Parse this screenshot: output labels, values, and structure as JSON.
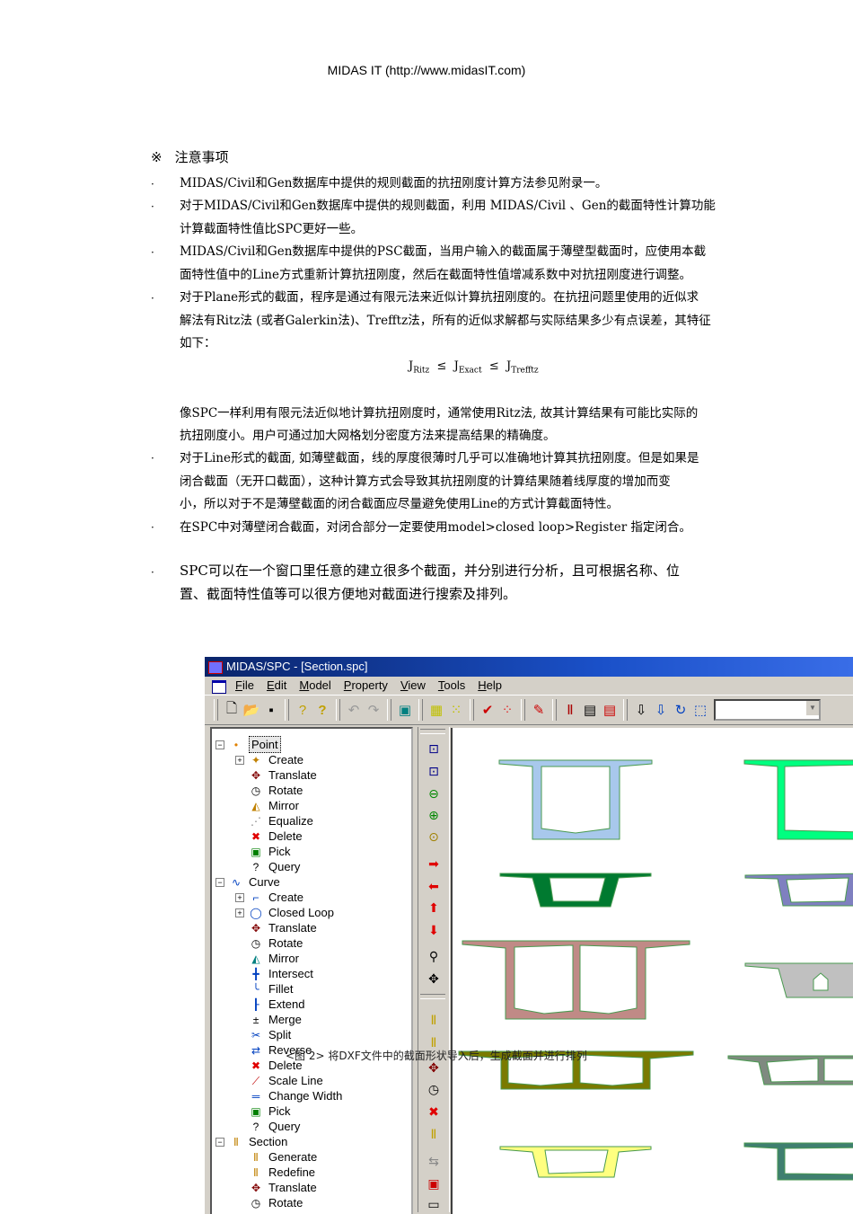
{
  "header": "MIDAS IT (http://www.midasIT.com)",
  "note": {
    "symbol": "※",
    "title": "注意事项"
  },
  "bullet": "·",
  "paragraphs": {
    "p1": "MIDAS/Civil和Gen数据库中提供的规则截面的抗扭刚度计算方法参见附录一。",
    "p2a": "对于MIDAS/Civil和Gen数据库中提供的规则截面，利用 MIDAS/Civil 、Gen的截面特性计算功能",
    "p2b": "计算截面特性值比SPC更好一些。",
    "p3a": "MIDAS/Civil和Gen数据库中提供的PSC截面，当用户输入的截面属于薄壁型截面时，应使用本截",
    "p3b": "面特性值中的Line方式重新计算抗扭刚度，然后在截面特性值增减系数中对抗扭刚度进行调整。",
    "p4a": "对于Plane形式的截面，程序是通过有限元法来近似计算抗扭刚度的。在抗扭问题里使用的近似求",
    "p4b": "解法有Ritz法 (或者Galerkin法)、Trefftz法，所有的近似求解都与实际结果多少有点误差，其特征",
    "p4c": "如下：",
    "p5a": "像SPC一样利用有限元法近似地计算抗扭刚度时，通常使用Ritz法, 故其计算结果有可能比实际的",
    "p5b": "抗扭刚度小。用户可通过加大网格划分密度方法来提高结果的精确度。",
    "p6a": "对于Line形式的截面, 如薄壁截面，线的厚度很薄时几乎可以准确地计算其抗扭刚度。但是如果是",
    "p6b": "闭合截面（无开口截面），这种计算方式会导致其抗扭刚度的计算结果随着线厚度的增加而变",
    "p6c": "小，所以对于不是薄壁截面的闭合截面应尽量避免使用Line的方式计算截面特性。",
    "p7": "在SPC中对薄壁闭合截面，对闭合部分一定要使用model>closed loop>Register 指定闭合。",
    "p8a": "SPC可以在一个窗口里任意的建立很多个截面，并分别进行分析，且可根据名称、位",
    "p8b": "置、截面特性值等可以很方便地对截面进行搜索及排列。"
  },
  "formula": {
    "j": "J",
    "ritz": "Ritz",
    "exact": "Exact",
    "trefftz": "Trefftz",
    "le": "≤"
  },
  "window": {
    "title": "MIDAS/SPC - [Section.spc]",
    "menu": [
      "File",
      "Edit",
      "Model",
      "Property",
      "View",
      "Tools",
      "Help"
    ],
    "tree": [
      {
        "label": "Point",
        "level": 0,
        "exp": "−",
        "icon": "point-icon",
        "glyph": "•",
        "color": "#e08000",
        "selected": true
      },
      {
        "label": "Create",
        "level": 1,
        "exp": "+",
        "icon": "create-icon",
        "glyph": "✦",
        "color": "#c08000"
      },
      {
        "label": "Translate",
        "level": 1,
        "icon": "translate-icon",
        "glyph": "✥",
        "color": "#800000"
      },
      {
        "label": "Rotate",
        "level": 1,
        "icon": "rotate-icon",
        "glyph": "◷",
        "color": "#000"
      },
      {
        "label": "Mirror",
        "level": 1,
        "icon": "mirror-icon",
        "glyph": "◭",
        "color": "#c08000"
      },
      {
        "label": "Equalize",
        "level": 1,
        "icon": "equalize-icon",
        "glyph": "⋰",
        "color": "#808080"
      },
      {
        "label": "Delete",
        "level": 1,
        "icon": "delete-icon",
        "glyph": "✖",
        "color": "#e00000"
      },
      {
        "label": "Pick",
        "level": 1,
        "icon": "pick-icon",
        "glyph": "▣",
        "color": "#008000"
      },
      {
        "label": "Query",
        "level": 1,
        "icon": "query-icon",
        "glyph": "?",
        "color": "#000"
      },
      {
        "label": "Curve",
        "level": 0,
        "exp": "−",
        "icon": "curve-icon",
        "glyph": "∿",
        "color": "#0040c0"
      },
      {
        "label": "Create",
        "level": 1,
        "exp": "+",
        "icon": "create-icon",
        "glyph": "⌐",
        "color": "#0040c0"
      },
      {
        "label": "Closed Loop",
        "level": 1,
        "exp": "+",
        "icon": "closed-loop-icon",
        "glyph": "◯",
        "color": "#0040c0"
      },
      {
        "label": "Translate",
        "level": 1,
        "icon": "translate-icon",
        "glyph": "✥",
        "color": "#800000"
      },
      {
        "label": "Rotate",
        "level": 1,
        "icon": "rotate-icon",
        "glyph": "◷",
        "color": "#000"
      },
      {
        "label": "Mirror",
        "level": 1,
        "icon": "mirror-icon",
        "glyph": "◭",
        "color": "#008080"
      },
      {
        "label": "Intersect",
        "level": 1,
        "icon": "intersect-icon",
        "glyph": "╋",
        "color": "#0040c0"
      },
      {
        "label": "Fillet",
        "level": 1,
        "icon": "fillet-icon",
        "glyph": "╰",
        "color": "#0040c0"
      },
      {
        "label": "Extend",
        "level": 1,
        "icon": "extend-icon",
        "glyph": "┠",
        "color": "#0040c0"
      },
      {
        "label": "Merge",
        "level": 1,
        "icon": "merge-icon",
        "glyph": "±",
        "color": "#000"
      },
      {
        "label": "Split",
        "level": 1,
        "icon": "split-icon",
        "glyph": "✂",
        "color": "#0040c0"
      },
      {
        "label": "Reverse",
        "level": 1,
        "icon": "reverse-icon",
        "glyph": "⇄",
        "color": "#0040c0"
      },
      {
        "label": "Delete",
        "level": 1,
        "icon": "delete-icon",
        "glyph": "✖",
        "color": "#e00000"
      },
      {
        "label": "Scale Line",
        "level": 1,
        "icon": "scale-line-icon",
        "glyph": "⟋",
        "color": "#c00000"
      },
      {
        "label": "Change Width",
        "level": 1,
        "icon": "change-width-icon",
        "glyph": "═",
        "color": "#0040c0"
      },
      {
        "label": "Pick",
        "level": 1,
        "icon": "pick-icon",
        "glyph": "▣",
        "color": "#008000"
      },
      {
        "label": "Query",
        "level": 1,
        "icon": "query-icon",
        "glyph": "?",
        "color": "#000"
      },
      {
        "label": "Section",
        "level": 0,
        "exp": "−",
        "icon": "section-icon",
        "glyph": "Ⅱ",
        "color": "#c08000"
      },
      {
        "label": "Generate",
        "level": 1,
        "icon": "generate-icon",
        "glyph": "Ⅱ",
        "color": "#c08000"
      },
      {
        "label": "Redefine",
        "level": 1,
        "icon": "redefine-icon",
        "glyph": "Ⅱ",
        "color": "#c08000"
      },
      {
        "label": "Translate",
        "level": 1,
        "icon": "translate-icon",
        "glyph": "✥",
        "color": "#800000"
      },
      {
        "label": "Rotate",
        "level": 1,
        "icon": "rotate-icon",
        "glyph": "◷",
        "color": "#000"
      }
    ],
    "section_colors": [
      "#a8c8ec",
      "#00ff80",
      "#007a30",
      "#7f80c0",
      "#c08a86",
      "#c0c0c0",
      "#7a7a00",
      "#7f8a80",
      "#ffff80",
      "#3f7f70"
    ]
  },
  "caption": "<图 2> 将DXF文件中的截面形状导入后，生成截面并进行排列"
}
